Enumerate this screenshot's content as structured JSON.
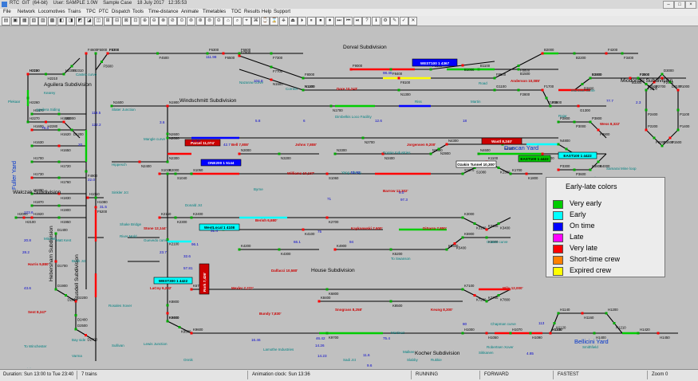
{
  "app": {
    "title": "RTC  GIT  (64-bit)    User: SAMPLE 1.0W    Sample Case    18 July 2017   12:35:53"
  },
  "menu": [
    "File",
    "Network",
    "Locomotives",
    "Trains",
    "TPC",
    "PTC",
    "Dispatch",
    "Tools",
    "Time-distance",
    "Animate",
    "Timetables",
    "TOC",
    "Results",
    "Help",
    "Support"
  ],
  "status": {
    "duration": "Duration: Sun 13:00 to Tue 23:40",
    "trains": "7 trains",
    "clock": "Animation clock: Sun 13:36",
    "state": "RUNNING",
    "direction": "FORWARD",
    "speed": "FASTEST",
    "zoom": "Zoom 0"
  },
  "legend": {
    "title": "Early-late colors",
    "items": [
      {
        "label": "Very early",
        "color": "#00cc00"
      },
      {
        "label": "Early",
        "color": "#00ffff"
      },
      {
        "label": "On time",
        "color": "#0000ff"
      },
      {
        "label": "Late",
        "color": "#ff00ff"
      },
      {
        "label": "Very late",
        "color": "#ff0000"
      },
      {
        "label": "Short-time crew",
        "color": "#ff8000"
      },
      {
        "label": "Expired crew",
        "color": "#ffff00"
      }
    ]
  },
  "subdivisions": [
    "Dorval Subdivision",
    "Miodonski Subdivision",
    "Aguilera Subdivision",
    "Windschmitt Subdivision",
    "Walczak Subdivision",
    "House Subdivision",
    "Hebersham Subdivision",
    "Trusdell Subdivision",
    "Kocher Subdivision"
  ],
  "yards": [
    "Fuller Yard",
    "Duncan Yard",
    "Bellicini Yard"
  ],
  "trains": [
    {
      "label": "WEST100 1 4367",
      "color": "#0000ff",
      "text": "#ffffff"
    },
    {
      "label": "Parcel 11,074'",
      "color": "#cc0000",
      "text": "#ffffff"
    },
    {
      "label": "ONE200 1 5144",
      "color": "#0000ff",
      "text": "#ffffff"
    },
    {
      "label": "Ozakin Tunnel 10,300'",
      "color": "#ffffff",
      "text": "#000000"
    },
    {
      "label": "Wastl 8,240'",
      "color": "#cc0000",
      "text": "#ffffff"
    },
    {
      "label": "EAST100 1 4422",
      "color": "#00cc00",
      "text": "#000000"
    },
    {
      "label": "EAST100 1 4422",
      "color": "#00ffff",
      "text": "#000000"
    },
    {
      "label": "WestLocal 1 4108",
      "color": "#00ffff",
      "text": "#000000"
    },
    {
      "label": "WEST300 1 4422",
      "color": "#00ffff",
      "text": "#000000"
    },
    {
      "label": "Rork 7,426'",
      "color": "#cc0000",
      "text": "#ffffff"
    }
  ],
  "locations": [
    "Castex curve",
    "Stone 12,144'",
    "Nazarow curve",
    "Correia",
    "Dore 10,243'",
    "Anderson 10,085'",
    "Morrison curve",
    "Kearey",
    "Plekaar",
    "Aguilera Siding",
    "Slater Junction",
    "Dimbelkis Loco Facility",
    "Martin",
    "Riss",
    "Road",
    "Wess 8,322'",
    "Samarai Mine loop",
    "Mangle curve",
    "Bell 7,808'",
    "Johns 7,808'",
    "Jorgensen 9,200'",
    "Rossie Industries",
    "Hippesch",
    "Williams 10,137'",
    "Yang Cheng",
    "Barrow 12,302'",
    "Kohey curve",
    "Byrne",
    "Donald Jct",
    "Sinkler Jct",
    "Shake Bridge",
    "River Mold",
    "Guevedo curve",
    "Berish 6,680'",
    "Kaykoowski 7,600'",
    "DiSarro 7,800'",
    "Coates curve",
    "To Swanson",
    "Dalfacci 10,580'",
    "LaCoy 6,282'",
    "Mexler 7,272'",
    "Bundy 7,830'",
    "Snograss 8,258'",
    "Keung 8,300'",
    "Wilu 12,000'",
    "Chapman curve",
    "Martinez",
    "Matt Kent",
    "Harris 9,880'",
    "Sent 8,247'",
    "Rosales Xover",
    "Lewis Junction",
    "Sullivan",
    "Varma",
    "Bay side",
    "Onnik",
    "Rinehart Road",
    "Lamothe Industries",
    "Sadi Jct",
    "Tsang",
    "Malkee",
    "Slabby",
    "Robertsen Xover",
    "Sikkanen",
    "Smithfield",
    "To Winchester",
    "To Hickey",
    "To Dixon",
    "To Pretorius",
    "Bush Jct",
    "Mitchell",
    "Rajar",
    "Rukkie",
    "Sunkan 6,825'"
  ],
  "stations": [
    "F4600",
    "F4900",
    "F5000",
    "F5200",
    "F5300",
    "F4500",
    "F4700",
    "F5600",
    "F6300",
    "F6500",
    "F6600",
    "F7300",
    "F7600",
    "F7700",
    "F8000",
    "F8100",
    "F8500",
    "F8800",
    "F9000",
    "F8400",
    "F9300",
    "B1000",
    "B1100",
    "B1500",
    "B2000",
    "B2200",
    "B3000",
    "B3300",
    "B3400",
    "B3800",
    "F4200",
    "F3400",
    "F3000",
    "F2400",
    "F2500",
    "F1500",
    "F1700",
    "F1000",
    "F3600",
    "G1300",
    "G1100",
    "F2800",
    "N1100",
    "N1300",
    "N1400",
    "N1500",
    "N1600",
    "N1700",
    "N1900",
    "N2000",
    "N2300",
    "N2400",
    "N2600",
    "N2700",
    "N3000",
    "N3200",
    "N3300",
    "N3400",
    "N3800",
    "N3900",
    "N4300",
    "N4500",
    "N4600",
    "N4700",
    "N4800",
    "S1000",
    "S1020",
    "S1040",
    "S1050",
    "S1060",
    "S1070",
    "S1080",
    "K1100",
    "K1300",
    "K1700",
    "K1800",
    "K2000",
    "K2100",
    "K2150",
    "K2300",
    "K2400",
    "K2700",
    "K3000",
    "K3100",
    "K3300",
    "K3400",
    "K3600",
    "K4100",
    "K4200",
    "K4300",
    "K4900",
    "K5200",
    "K5300",
    "K5400",
    "K5900",
    "K6000",
    "K6700",
    "K6800",
    "K7100",
    "K7200",
    "K7700",
    "K7800",
    "K8400",
    "K8500",
    "K8800",
    "K9000",
    "K9400",
    "K9500",
    "K9600",
    "K9700",
    "H1000",
    "H1050",
    "H1070",
    "H1090",
    "H1100",
    "H1120",
    "H1140",
    "H1160",
    "H1200",
    "H1210",
    "H1230",
    "H1400",
    "H1420",
    "H1450",
    "H1470",
    "H1500",
    "H1600",
    "H1620",
    "H1630",
    "H1650",
    "H1700",
    "H1720",
    "H1730",
    "H1760",
    "H1800",
    "H1830",
    "H1870",
    "H1900",
    "H1920",
    "H1950",
    "H2000",
    "H2100",
    "H2120",
    "H2210",
    "H2250",
    "H2260",
    "H2270",
    "H2280",
    "H2300",
    "H2310",
    "D1000",
    "D1200",
    "D1400",
    "D1700",
    "D1900",
    "D2000",
    "D2200",
    "D2400",
    "D2500",
    "D2700",
    "D3000",
    "D3100",
    "P1000",
    "P1100",
    "P1400",
    "P1500",
    "P1600",
    "P2000",
    "P2200",
    "P2400",
    "P2500",
    "P2700",
    "P2800",
    "P3000",
    "P3300",
    "P3600",
    "P3800",
    "P3900",
    "K3800",
    "K4000",
    "H1010",
    "H1080"
  ]
}
